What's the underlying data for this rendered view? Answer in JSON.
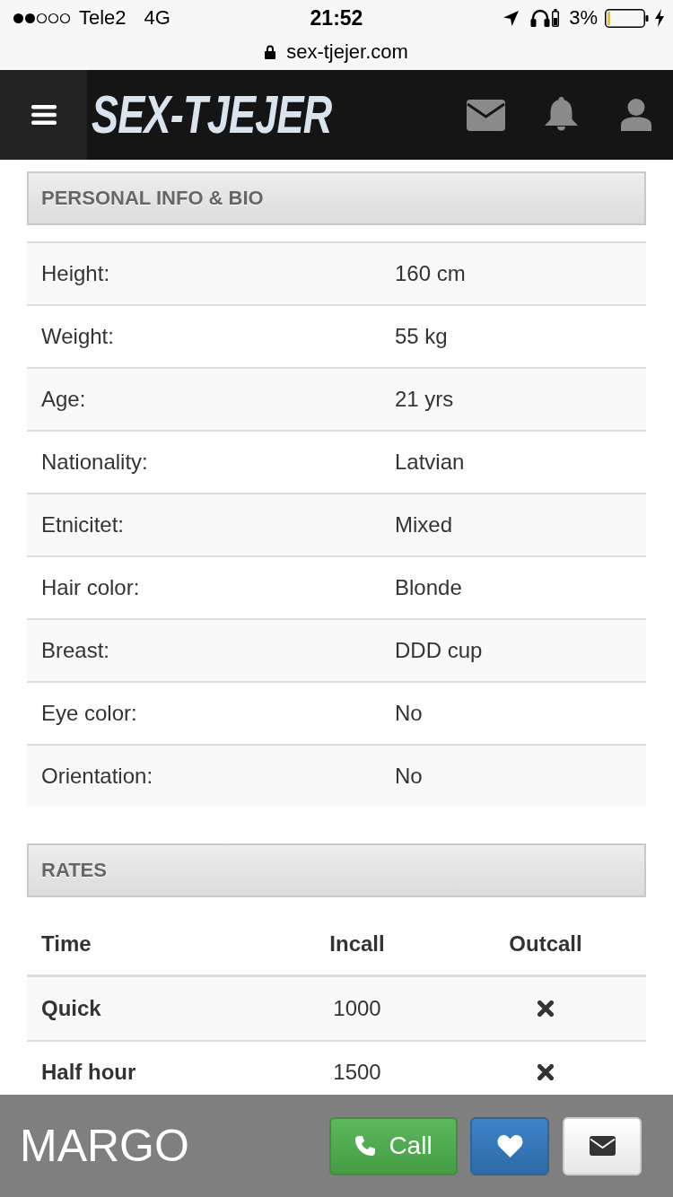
{
  "status_bar": {
    "carrier": "Tele2",
    "network": "4G",
    "time": "21:52",
    "battery_percent": "3%"
  },
  "address_bar": {
    "url": "sex-tjejer.com"
  },
  "header": {
    "logo": "SEX-TJEJER"
  },
  "personal_info": {
    "title": "PERSONAL INFO & BIO",
    "rows": [
      {
        "label": "Height:",
        "value": "160 cm"
      },
      {
        "label": "Weight:",
        "value": "55 kg"
      },
      {
        "label": "Age:",
        "value": "21 yrs"
      },
      {
        "label": "Nationality:",
        "value": "Latvian"
      },
      {
        "label": "Etnicitet:",
        "value": "Mixed"
      },
      {
        "label": "Hair color:",
        "value": "Blonde"
      },
      {
        "label": "Breast:",
        "value": "DDD cup"
      },
      {
        "label": "Eye color:",
        "value": "No"
      },
      {
        "label": "Orientation:",
        "value": "No"
      }
    ]
  },
  "rates": {
    "title": "RATES",
    "columns": [
      "Time",
      "Incall",
      "Outcall"
    ],
    "rows": [
      {
        "time": "Quick",
        "incall": "1000",
        "outcall": false
      },
      {
        "time": "Half hour",
        "incall": "1500",
        "outcall": false
      }
    ]
  },
  "bottom_bar": {
    "name": "MARGO",
    "call_button": "Call"
  }
}
